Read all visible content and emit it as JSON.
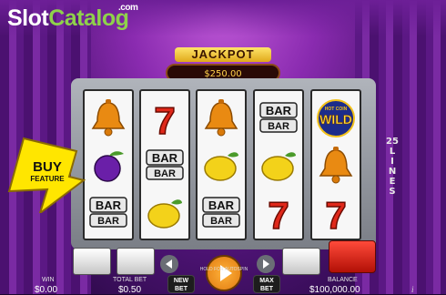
{
  "logo": {
    "part1": "Slot",
    "part2": "Catalog",
    "suffix": ".com"
  },
  "jackpot": {
    "title": "JACKPOT",
    "value": "$250.00"
  },
  "reels": [
    [
      "bell",
      "cherry-plum",
      "bar"
    ],
    [
      "seven",
      "bar",
      "lemon"
    ],
    [
      "bell",
      "lemon",
      "bar"
    ],
    [
      "bar",
      "lemon",
      "seven"
    ],
    [
      "wild",
      "bell",
      "seven"
    ]
  ],
  "symbols": {
    "bar_label": "BAR",
    "wild_label": "WILD",
    "wild_top": "HOT COIN"
  },
  "lines": {
    "count": "25",
    "label": "LINES"
  },
  "buy_feature": {
    "line1": "BUY",
    "line2": "FEATURE"
  },
  "bottom": {
    "win_label": "WIN",
    "win_value": "$0.00",
    "total_bet_label": "TOTAL BET",
    "total_bet_value": "$0.50",
    "balance_label": "BALANCE",
    "balance_value": "$100,000.00",
    "new_bet_line1": "NEW",
    "new_bet_line2": "BET",
    "max_bet_line1": "MAX",
    "max_bet_line2": "BET",
    "hold_text": "HOLD FOR AUTOSPIN",
    "info": "i"
  },
  "colors": {
    "accent": "#ffd24a",
    "redkey": "#e0281a",
    "brand_green": "#8fd14b"
  }
}
